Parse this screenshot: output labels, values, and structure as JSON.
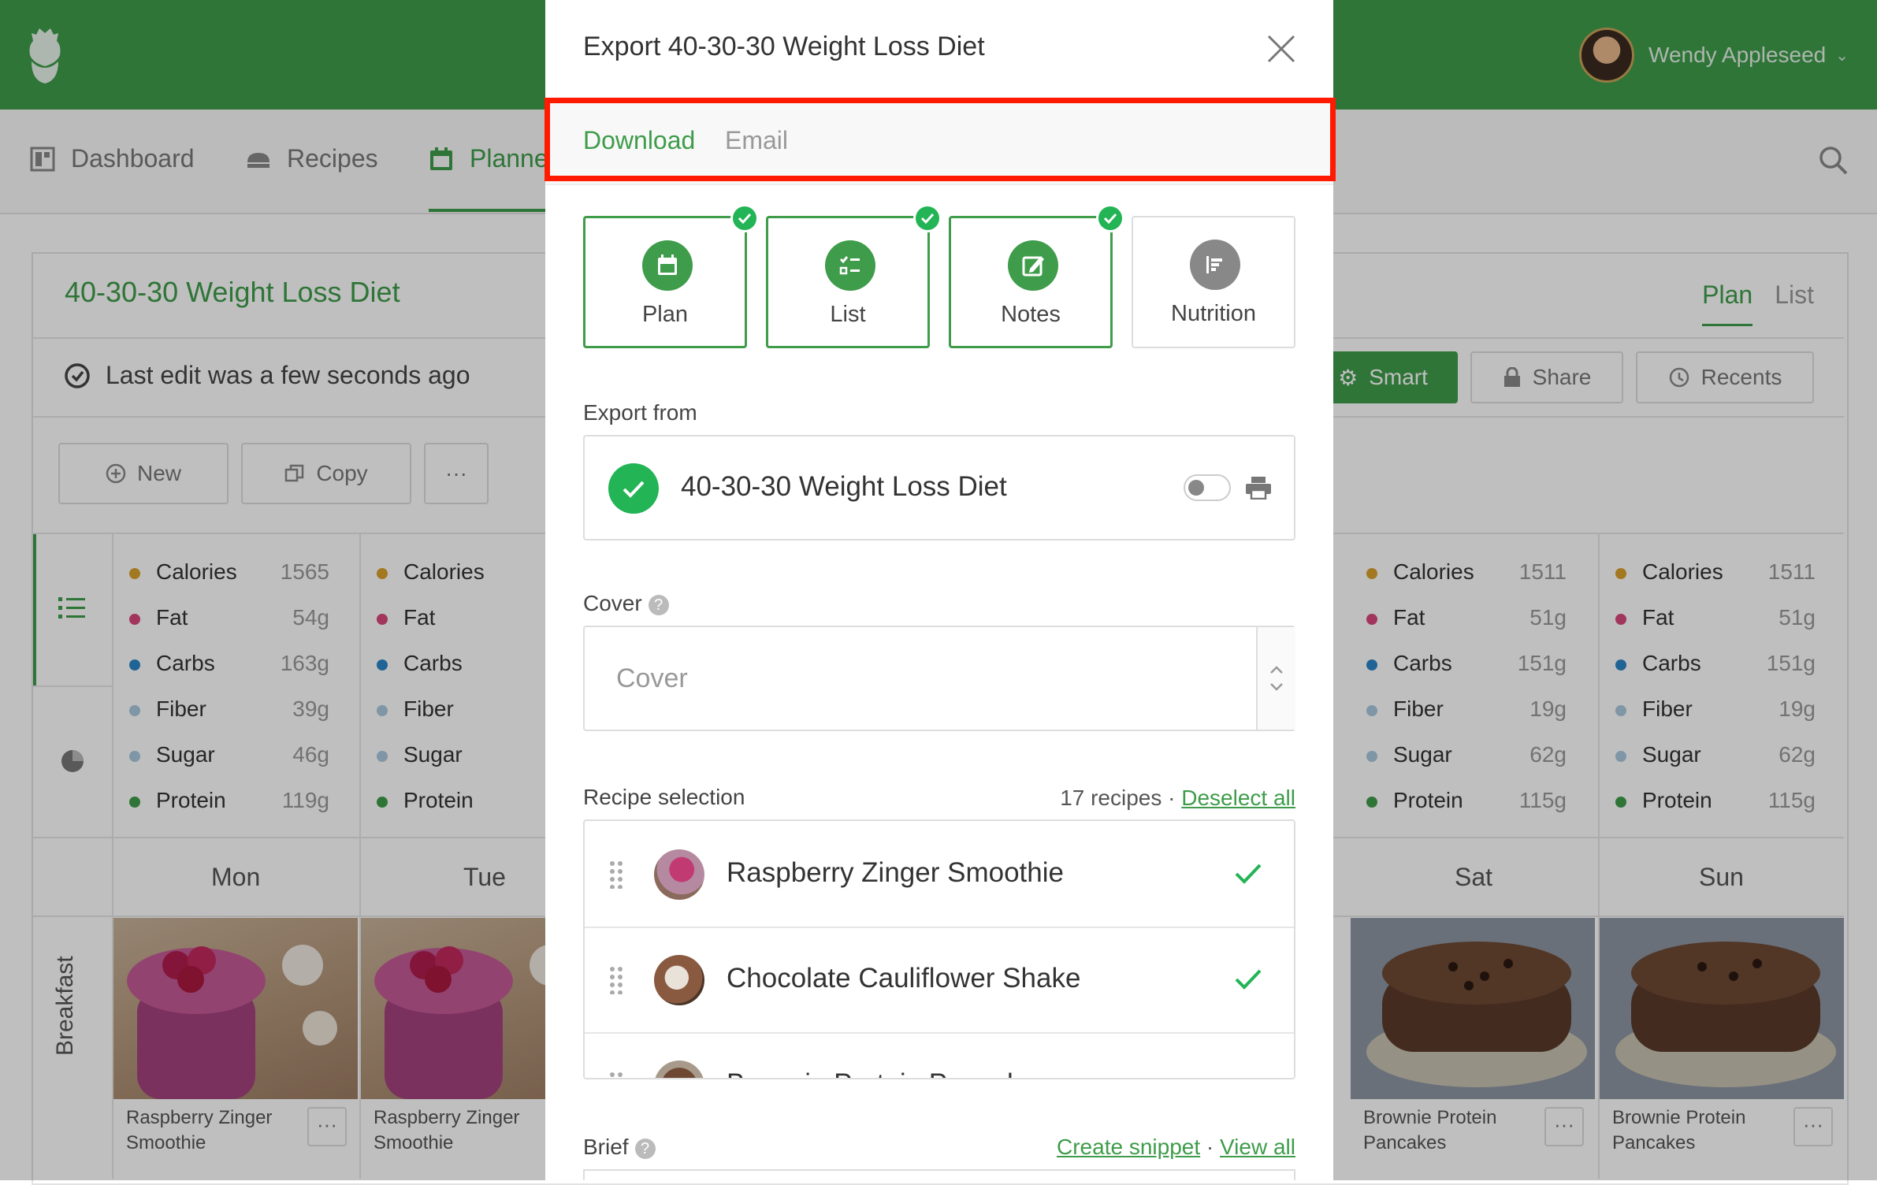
{
  "header": {
    "user_name": "Wendy Appleseed"
  },
  "nav": {
    "items": [
      {
        "label": "Dashboard",
        "icon": "dashboard-icon"
      },
      {
        "label": "Recipes",
        "icon": "recipes-icon"
      },
      {
        "label": "Planne",
        "icon": "calendar-icon"
      }
    ],
    "search_icon": "search-icon"
  },
  "plan": {
    "title": "40-30-30 Weight Loss Diet",
    "tabs": [
      "Plan",
      "List"
    ],
    "last_edit": "Last edit was a few seconds ago",
    "buttons": {
      "new": "New",
      "copy": "Copy",
      "smart": "Smart",
      "share": "Share",
      "recents": "Recents"
    },
    "nutrition_columns": [
      {
        "rows": [
          [
            "Calories",
            "1565"
          ],
          [
            "Fat",
            "54g"
          ],
          [
            "Carbs",
            "163g"
          ],
          [
            "Fiber",
            "39g"
          ],
          [
            "Sugar",
            "46g"
          ],
          [
            "Protein",
            "119g"
          ]
        ]
      },
      {
        "rows": [
          [
            "Calories",
            ""
          ],
          [
            "Fat",
            ""
          ],
          [
            "Carbs",
            ""
          ],
          [
            "Fiber",
            ""
          ],
          [
            "Sugar",
            ""
          ],
          [
            "Protein",
            ""
          ]
        ]
      },
      {
        "rows": [
          [
            "Calories",
            "1511"
          ],
          [
            "Fat",
            "51g"
          ],
          [
            "Carbs",
            "151g"
          ],
          [
            "Fiber",
            "19g"
          ],
          [
            "Sugar",
            "62g"
          ],
          [
            "Protein",
            "115g"
          ]
        ]
      },
      {
        "rows": [
          [
            "Calories",
            "1511"
          ],
          [
            "Fat",
            "51g"
          ],
          [
            "Carbs",
            "151g"
          ],
          [
            "Fiber",
            "19g"
          ],
          [
            "Sugar",
            "62g"
          ],
          [
            "Protein",
            "115g"
          ]
        ]
      }
    ],
    "nutrient_colors": {
      "Calories": "#d9a12b",
      "Fat": "#d9477a",
      "Carbs": "#2b86c9",
      "Fiber": "#a9c8dd",
      "Sugar": "#a9c8dd",
      "Protein": "#3e9c4a"
    },
    "days": [
      "Mon",
      "Tue",
      "Sat",
      "Sun"
    ],
    "meal_label": "Breakfast",
    "meals": [
      "Raspberry Zinger Smoothie",
      "Raspberry Zinger Smoothie",
      "Brownie Protein Pancakes",
      "Brownie Protein Pancakes"
    ]
  },
  "modal": {
    "title": "Export 40-30-30 Weight Loss Diet",
    "tabs": {
      "download": "Download",
      "email": "Email"
    },
    "options": [
      {
        "label": "Plan",
        "selected": true
      },
      {
        "label": "List",
        "selected": true
      },
      {
        "label": "Notes",
        "selected": true
      },
      {
        "label": "Nutrition",
        "selected": false
      }
    ],
    "export_from_label": "Export from",
    "export_from_value": "40-30-30 Weight Loss Diet",
    "cover_label": "Cover",
    "cover_placeholder": "Cover",
    "recipe_selection_label": "Recipe selection",
    "recipe_count": "17 recipes",
    "deselect_all": "Deselect all",
    "recipes": [
      "Raspberry Zinger Smoothie",
      "Chocolate Cauliflower Shake",
      "Brownie Protein Pancakes"
    ],
    "brief_label": "Brief",
    "create_snippet": "Create snippet",
    "view_all": "View all",
    "separator": "·"
  },
  "colors": {
    "brand_green": "#3e9c4a",
    "highlight_red": "#ff1a00",
    "check_green": "#22b455"
  }
}
